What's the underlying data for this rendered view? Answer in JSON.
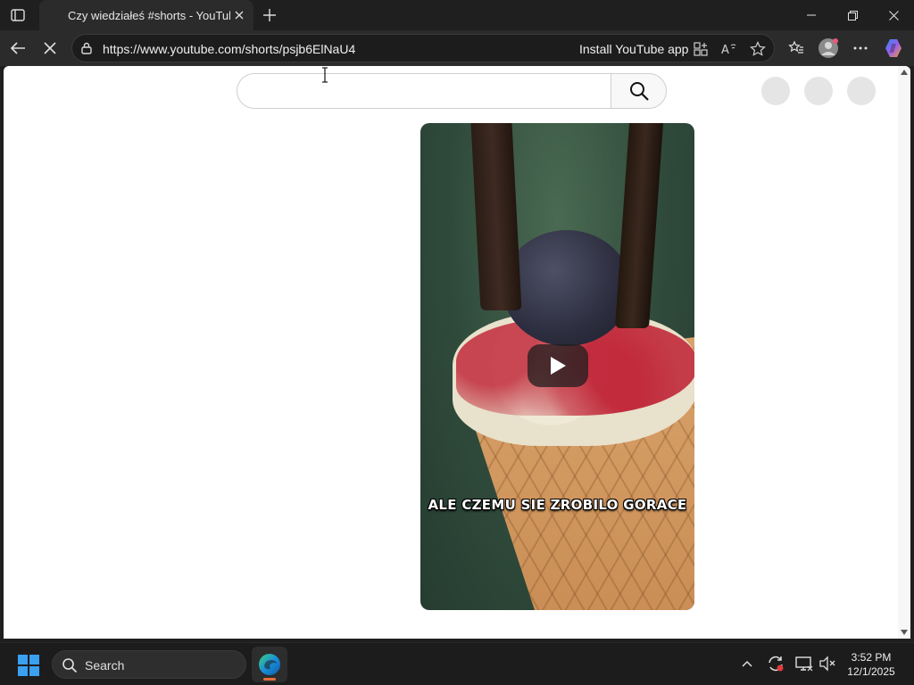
{
  "browser": {
    "tab_title": "Czy wiedziałeś #shorts - YouTube",
    "url": "https://www.youtube.com/shorts/psjb6ElNaU4",
    "install_app_label": "Install YouTube app"
  },
  "page": {
    "search_placeholder": "",
    "video_caption": "ALE CZEMU SIE ZROBILO GORACE"
  },
  "taskbar": {
    "search_label": "Search",
    "time": "3:52 PM",
    "date": "12/1/2025"
  },
  "colors": {
    "accent_edge": "#e86d3a",
    "windows_blue": "#3aa0f0"
  }
}
